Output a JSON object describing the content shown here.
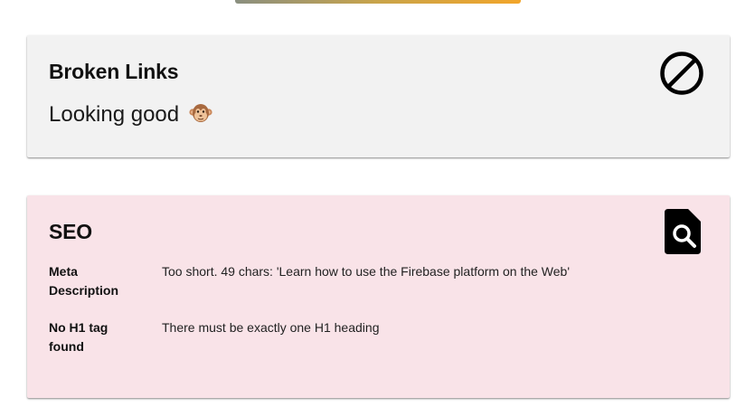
{
  "broken_links": {
    "title": "Broken Links",
    "status": "Looking good",
    "status_icon": "monkey-face-emoji",
    "header_icon": "block-icon"
  },
  "seo": {
    "title": "SEO",
    "header_icon": "find-in-page-icon",
    "background": "#f9e3e8",
    "issues": [
      {
        "label": "Meta Description",
        "message": "Too short. 49 chars: 'Learn how to use the Firebase platform on the Web'"
      },
      {
        "label": "No H1 tag found",
        "message": "There must be exactly one H1 heading"
      }
    ]
  }
}
